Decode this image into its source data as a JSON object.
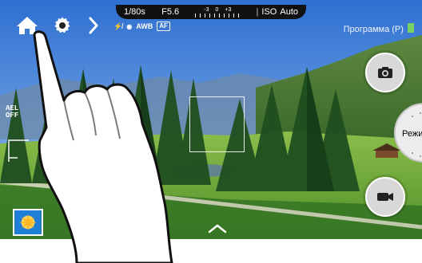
{
  "top_bar": {
    "shutter_speed": "1/80s",
    "aperture": "F5.6",
    "exposure_scale": {
      "minus": "-3",
      "zero": "0",
      "plus": "+3"
    },
    "iso_label": "ISO",
    "iso_value": "Auto"
  },
  "mode_text": "Программа (P)",
  "toolbar_icons": {
    "strip_items": [
      "flash-off",
      "metering-center",
      "AWB",
      "AF"
    ],
    "awb_label": "AWB",
    "af_label": "AF"
  },
  "ael": {
    "line1": "AEL",
    "line2": "OFF"
  },
  "mode_button_label": "Режим",
  "colors": {
    "pill_bg": "#111111",
    "battery": "#7ed957",
    "button_gray": "#d8d8d8"
  }
}
